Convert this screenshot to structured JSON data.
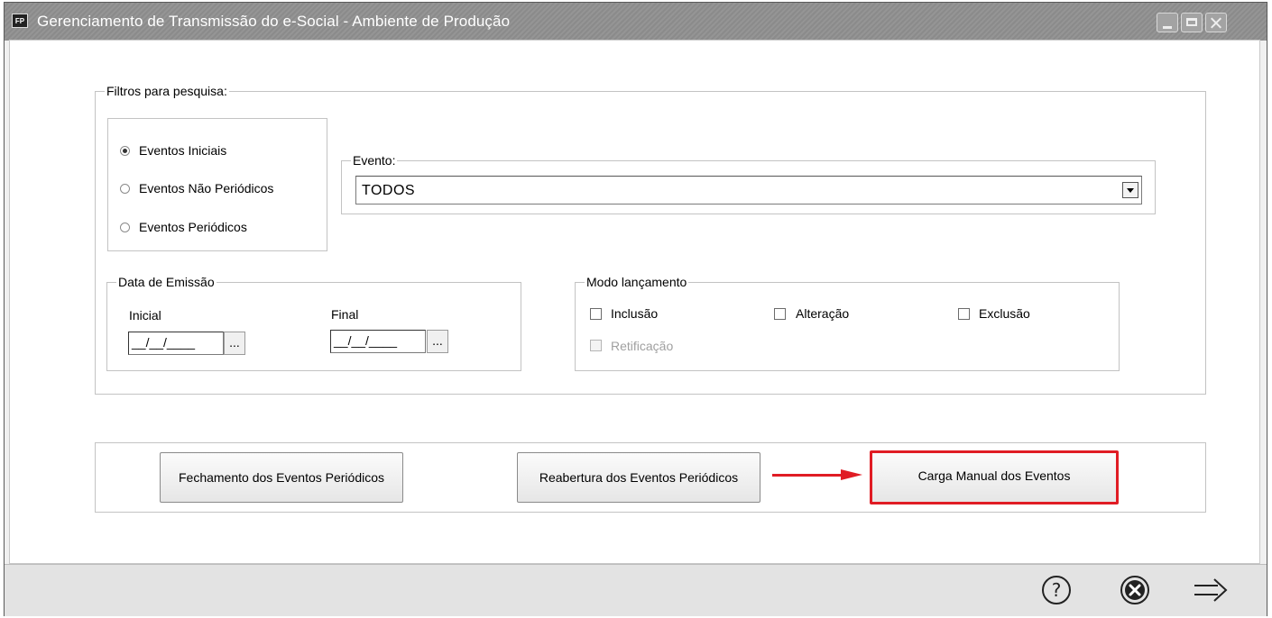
{
  "window": {
    "app_icon_label": "FP",
    "title": "Gerenciamento de Transmissão do e-Social - Ambiente de Produção"
  },
  "filters": {
    "legend": "Filtros para pesquisa:",
    "event_types": [
      {
        "label": "Eventos Iniciais",
        "checked": true
      },
      {
        "label": "Eventos Não Periódicos",
        "checked": false
      },
      {
        "label": "Eventos Periódicos",
        "checked": false
      }
    ],
    "evento": {
      "legend": "Evento:",
      "selected": "TODOS"
    },
    "data_emissao": {
      "legend": "Data de Emissão",
      "initial_label": "Inicial",
      "initial_value": "__/__/____",
      "final_label": "Final",
      "final_value": "__/__/____",
      "picker_label": "..."
    },
    "modo_lancamento": {
      "legend": "Modo lançamento",
      "options": [
        {
          "label": "Inclusão",
          "checked": false,
          "enabled": true
        },
        {
          "label": "Alteração",
          "checked": false,
          "enabled": true
        },
        {
          "label": "Exclusão",
          "checked": false,
          "enabled": true
        },
        {
          "label": "Retificação",
          "checked": false,
          "enabled": false
        }
      ]
    }
  },
  "actions": {
    "fechamento": "Fechamento dos Eventos Periódicos",
    "reabertura": "Reabertura dos Eventos Periódicos",
    "carga_manual": "Carga Manual dos Eventos"
  },
  "footer": {
    "icons": [
      "help-icon",
      "cancel-icon",
      "next-arrow-icon"
    ]
  },
  "colors": {
    "highlight": "#e01c24",
    "titlebar": "#8f8f8f"
  }
}
